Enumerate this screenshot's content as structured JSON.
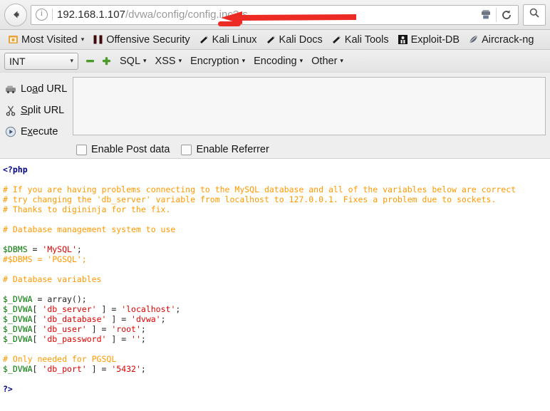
{
  "browser": {
    "back_button": "back-arrow",
    "identity_icon": "info",
    "url_host": "192.168.1.107",
    "url_path": "/dvwa/config/config.inc?-s",
    "reader_icon": "reader-view-icon",
    "reload_icon": "reload-icon",
    "search_icon": "search-icon"
  },
  "bookmarks": [
    {
      "label": "Most Visited",
      "icon": "most-visited-icon",
      "caret": "▾"
    },
    {
      "label": "Offensive Security",
      "icon": "offensive-security-icon",
      "caret": ""
    },
    {
      "label": "Kali Linux",
      "icon": "kali-icon",
      "caret": ""
    },
    {
      "label": "Kali Docs",
      "icon": "kali-icon",
      "caret": ""
    },
    {
      "label": "Kali Tools",
      "icon": "kali-icon",
      "caret": ""
    },
    {
      "label": "Exploit-DB",
      "icon": "exploit-db-icon",
      "caret": ""
    },
    {
      "label": "Aircrack-ng",
      "icon": "aircrack-icon",
      "caret": ""
    }
  ],
  "hackbar": {
    "type_select": {
      "value": "INT",
      "caret": "▾"
    },
    "minus_icon": "minus-icon",
    "plus_icon": "plus-icon",
    "menus": [
      {
        "label": "SQL",
        "caret": "▾"
      },
      {
        "label": "XSS",
        "caret": "▾"
      },
      {
        "label": "Encryption",
        "caret": "▾"
      },
      {
        "label": "Encoding",
        "caret": "▾"
      },
      {
        "label": "Other",
        "caret": "▾"
      }
    ],
    "actions": [
      {
        "label": "Load URL",
        "icon": "load-url-icon"
      },
      {
        "label": "Split URL",
        "icon": "split-url-icon"
      },
      {
        "label": "Execute",
        "icon": "execute-icon"
      }
    ],
    "textarea_value": "",
    "checkboxes": [
      {
        "label": "Enable Post data",
        "checked": false
      },
      {
        "label": "Enable Referrer",
        "checked": false
      }
    ]
  },
  "source": {
    "lines": [
      [
        {
          "t": "<?php",
          "c": "tag"
        }
      ],
      [],
      [
        {
          "t": "# If you are having problems connecting to the MySQL database and all of the variables below are correct",
          "c": "com"
        }
      ],
      [
        {
          "t": "# try changing the 'db_server' variable from localhost to 127.0.0.1. Fixes a problem due to sockets.",
          "c": "com"
        }
      ],
      [
        {
          "t": "# Thanks to digininja for the fix.",
          "c": "com"
        }
      ],
      [],
      [
        {
          "t": "# Database management system to use",
          "c": "com"
        }
      ],
      [],
      [
        {
          "t": "$DBMS",
          "c": "var"
        },
        {
          "t": " = ",
          "c": "def"
        },
        {
          "t": "'MySQL'",
          "c": "str"
        },
        {
          "t": ";",
          "c": "def"
        }
      ],
      [
        {
          "t": "#$DBMS = 'PGSQL';",
          "c": "com"
        }
      ],
      [],
      [
        {
          "t": "# Database variables",
          "c": "com"
        }
      ],
      [],
      [
        {
          "t": "$_DVWA",
          "c": "var"
        },
        {
          "t": " = array();",
          "c": "def"
        }
      ],
      [
        {
          "t": "$_DVWA",
          "c": "var"
        },
        {
          "t": "[ ",
          "c": "def"
        },
        {
          "t": "'db_server'",
          "c": "str"
        },
        {
          "t": " ] = ",
          "c": "def"
        },
        {
          "t": "'localhost'",
          "c": "str"
        },
        {
          "t": ";",
          "c": "def"
        }
      ],
      [
        {
          "t": "$_DVWA",
          "c": "var"
        },
        {
          "t": "[ ",
          "c": "def"
        },
        {
          "t": "'db_database'",
          "c": "str"
        },
        {
          "t": " ] = ",
          "c": "def"
        },
        {
          "t": "'dvwa'",
          "c": "str"
        },
        {
          "t": ";",
          "c": "def"
        }
      ],
      [
        {
          "t": "$_DVWA",
          "c": "var"
        },
        {
          "t": "[ ",
          "c": "def"
        },
        {
          "t": "'db_user'",
          "c": "str"
        },
        {
          "t": " ] = ",
          "c": "def"
        },
        {
          "t": "'root'",
          "c": "str"
        },
        {
          "t": ";",
          "c": "def"
        }
      ],
      [
        {
          "t": "$_DVWA",
          "c": "var"
        },
        {
          "t": "[ ",
          "c": "def"
        },
        {
          "t": "'db_password'",
          "c": "str"
        },
        {
          "t": " ] = ",
          "c": "def"
        },
        {
          "t": "''",
          "c": "str"
        },
        {
          "t": ";",
          "c": "def"
        }
      ],
      [],
      [
        {
          "t": "# Only needed for PGSQL",
          "c": "com"
        }
      ],
      [
        {
          "t": "$_DVWA",
          "c": "var"
        },
        {
          "t": "[ ",
          "c": "def"
        },
        {
          "t": "'db_port'",
          "c": "str"
        },
        {
          "t": " ] = ",
          "c": "def"
        },
        {
          "t": "'5432'",
          "c": "str"
        },
        {
          "t": ";",
          "c": "def"
        }
      ],
      [],
      [
        {
          "t": "?>",
          "c": "tag"
        }
      ]
    ]
  },
  "annotation": {
    "arrow_color": "#ec2b25",
    "arrow_direction": "left",
    "underline_color": "#ec2b25"
  },
  "colors": {
    "php_tag": "#000080",
    "comment": "#ff9900",
    "variable": "#007700",
    "string": "#dd0000",
    "default_text": "#222222",
    "accent_red": "#ec2b25"
  }
}
